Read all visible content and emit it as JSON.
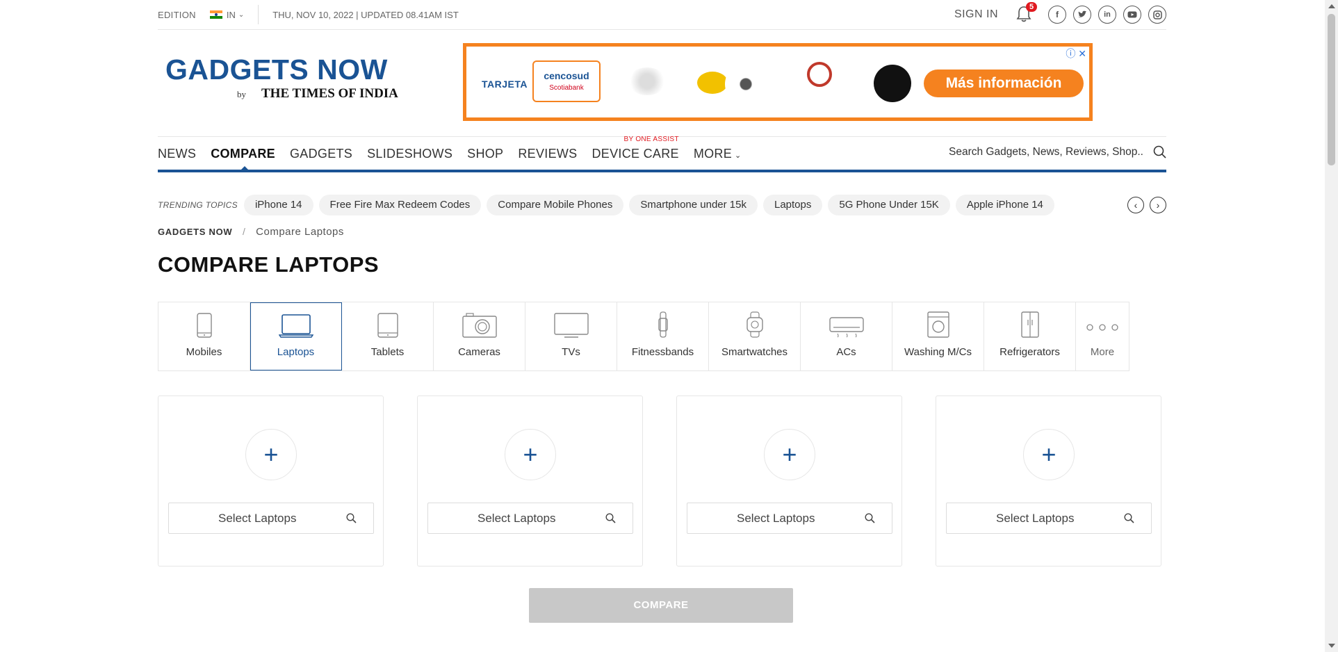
{
  "topbar": {
    "edition_label": "EDITION",
    "edition_value": "IN",
    "date_text": "THU, NOV 10, 2022 | UPDATED 08.41AM IST",
    "sign_in": "SIGN IN",
    "notifications_count": "5",
    "social_icons": [
      "facebook-icon",
      "twitter-icon",
      "linkedin-icon",
      "youtube-icon",
      "instagram-icon"
    ]
  },
  "header": {
    "logo_main": "GADGETS NOW",
    "logo_by": "by",
    "logo_sub": "THE TIMES OF INDIA"
  },
  "ad": {
    "tarjeta": "TARJETA",
    "card_brand": "cencosud",
    "card_bank": "Scotiabank",
    "cta": "Más información",
    "brand_colors": {
      "orange": "#f5821f",
      "blue": "#1a5394"
    }
  },
  "nav": {
    "items": [
      {
        "label": "NEWS"
      },
      {
        "label": "COMPARE",
        "active": true
      },
      {
        "label": "GADGETS"
      },
      {
        "label": "SLIDESHOWS"
      },
      {
        "label": "SHOP"
      },
      {
        "label": "REVIEWS"
      },
      {
        "label": "DEVICE CARE",
        "tag": "BY ONE ASSIST"
      },
      {
        "label": "MORE"
      }
    ],
    "search_placeholder": "Search Gadgets, News, Reviews, Shop.."
  },
  "trending": {
    "label": "TRENDING TOPICS",
    "topics": [
      "iPhone 14",
      "Free Fire Max Redeem Codes",
      "Compare Mobile Phones",
      "Smartphone under 15k",
      "Laptops",
      "5G Phone Under 15K",
      "Apple iPhone 14"
    ]
  },
  "breadcrumb": {
    "home": "GADGETS NOW",
    "separator": "/",
    "current": "Compare Laptops"
  },
  "page_title": "COMPARE LAPTOPS",
  "categories": [
    {
      "label": "Mobiles",
      "icon": "mobile-icon"
    },
    {
      "label": "Laptops",
      "icon": "laptop-icon",
      "active": true
    },
    {
      "label": "Tablets",
      "icon": "tablet-icon"
    },
    {
      "label": "Cameras",
      "icon": "camera-icon"
    },
    {
      "label": "TVs",
      "icon": "tv-icon"
    },
    {
      "label": "Fitnessbands",
      "icon": "fitnessband-icon"
    },
    {
      "label": "Smartwatches",
      "icon": "smartwatch-icon"
    },
    {
      "label": "ACs",
      "icon": "ac-icon"
    },
    {
      "label": "Washing M/Cs",
      "icon": "washing-machine-icon"
    },
    {
      "label": "Refrigerators",
      "icon": "refrigerator-icon"
    },
    {
      "label": "More",
      "icon": "more-dots-icon"
    }
  ],
  "slots": [
    {
      "plus": "+",
      "select_label": "Select Laptops"
    },
    {
      "plus": "+",
      "select_label": "Select Laptops"
    },
    {
      "plus": "+",
      "select_label": "Select Laptops"
    },
    {
      "plus": "+",
      "select_label": "Select Laptops"
    }
  ],
  "compare_button": "COMPARE"
}
